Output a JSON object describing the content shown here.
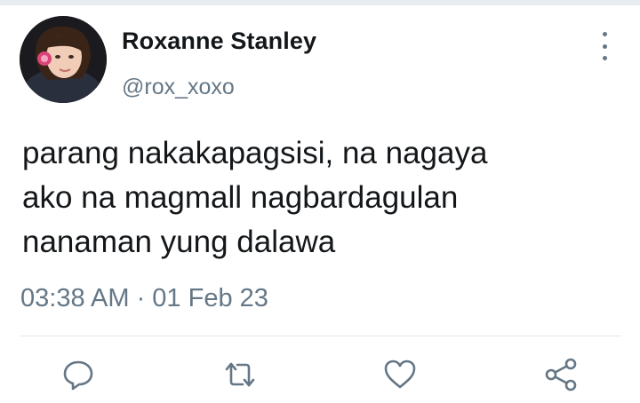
{
  "tweet": {
    "author": {
      "display_name": "Roxanne Stanley",
      "handle": "@rox_xoxo",
      "avatar_icon": "profile-photo"
    },
    "text_lines": [
      "parang nakakapagsisi, na nagaya",
      "ako na magmall nagbardagulan",
      "nanaman yung dalawa"
    ],
    "timestamp": "03:38 AM · 01 Feb 23",
    "actions": {
      "reply_icon": "reply-icon",
      "retweet_icon": "retweet-icon",
      "like_icon": "heart-icon",
      "share_icon": "share-icon"
    },
    "more_icon": "more-vertical-icon"
  },
  "colors": {
    "text": "#14171a",
    "secondary": "#657786",
    "divider": "#e1e8ed"
  }
}
